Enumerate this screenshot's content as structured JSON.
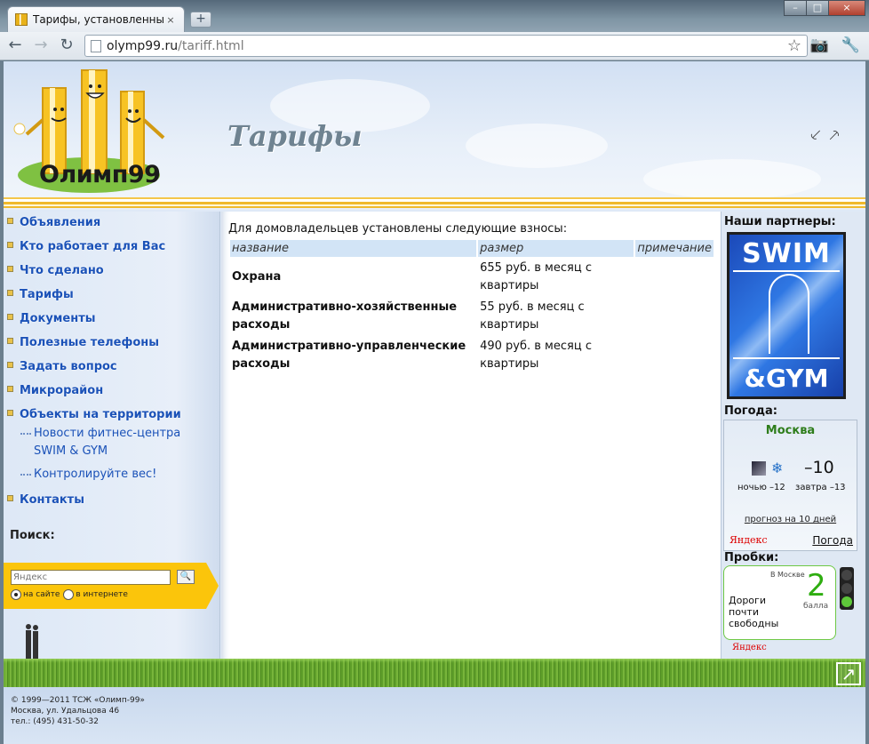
{
  "browser": {
    "tab_title": "Тарифы, установленны...",
    "tab_close": "×",
    "new_tab": "+",
    "url_host": "olymp99.ru",
    "url_path": "/tariff.html",
    "win_min": "–",
    "win_max": "□",
    "win_close": "×",
    "back": "←",
    "forward": "→",
    "reload": "↻",
    "star": "☆",
    "camera": "📷",
    "wrench": "🔧"
  },
  "header": {
    "logo_text": "Олимп99",
    "page_title": "Тарифы",
    "birds": "⸔ ⸕"
  },
  "menu": {
    "items": [
      "Объявления",
      "Кто работает для Вас",
      "Что сделано",
      "Тарифы",
      "Документы",
      "Полезные телефоны",
      "Задать вопрос",
      "Микрорайон",
      "Объекты на территории",
      "Контакты"
    ],
    "subitems": [
      "Новости фитнес-центра",
      "SWIM & GYM",
      "Контролируйте вес!"
    ]
  },
  "search": {
    "label": "Поиск:",
    "placeholder": "Яндекс",
    "button": "🔍",
    "option_site": "на сайте",
    "option_web": "в интернете"
  },
  "content": {
    "intro": "Для домовладельцев установлены следующие взносы:",
    "columns": [
      "название",
      "размер",
      "примечание"
    ],
    "rows": [
      {
        "name": "Охрана",
        "amount": "655 руб. в месяц с квартиры",
        "note": ""
      },
      {
        "name": "Административно-хозяйственные расходы",
        "amount": "55 руб. в месяц с квартиры",
        "note": ""
      },
      {
        "name": "Административно-управленческие расходы",
        "amount": "490 руб. в месяц с квартиры",
        "note": ""
      }
    ]
  },
  "right": {
    "partners_title": "Наши партнеры:",
    "partner_top": "SWIM",
    "partner_bottom": "&GYM",
    "weather_title": "Погода:",
    "city": "Москва",
    "temp": "–10",
    "night": "ночью –12",
    "tomorrow": "завтра –13",
    "forecast": "прогноз на 10 дней",
    "yandex": "Яндекс",
    "weather_link": "Погода",
    "traffic_title": "Пробки:",
    "traffic_city": "В Москве",
    "traffic_score": "2",
    "traffic_unit": "балла",
    "traffic_desc": "Дороги почти свободны",
    "yandex2": "Яндекс"
  },
  "footer": {
    "copyright": "© 1999—2011 ТСЖ «Олимп-99»",
    "address": "Москва, ул. Удальцова 46",
    "phone": "тел.: (495) 431-50-32",
    "top_arrow": "↗"
  }
}
